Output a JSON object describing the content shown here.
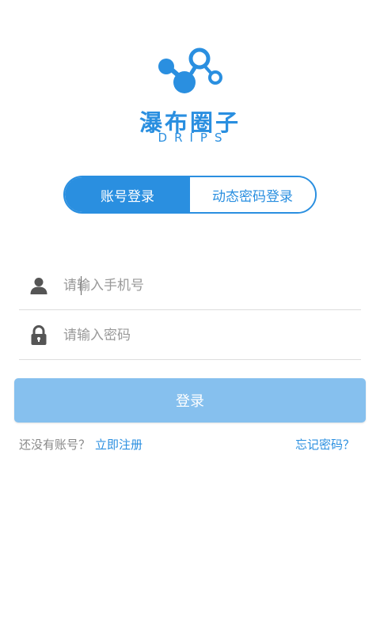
{
  "brand": {
    "name": "瀑布圈子",
    "subtitle": "DRIPS"
  },
  "tabs": [
    {
      "label": "账号登录",
      "active": true
    },
    {
      "label": "动态密码登录",
      "active": false
    }
  ],
  "form": {
    "phone_placeholder": "请输入手机号",
    "password_placeholder": "请输入密码",
    "user_icon": "user-icon",
    "lock_icon": "lock-icon"
  },
  "login_button": "登录",
  "footer": {
    "no_account_text": "还没有账号？",
    "register_link": "立即注册",
    "forgot_link": "忘记密码？"
  },
  "colors": {
    "accent": "#2a8fe0",
    "button_disabled": "#86c0ee",
    "muted_text": "#888888",
    "divider": "#dddddd"
  }
}
